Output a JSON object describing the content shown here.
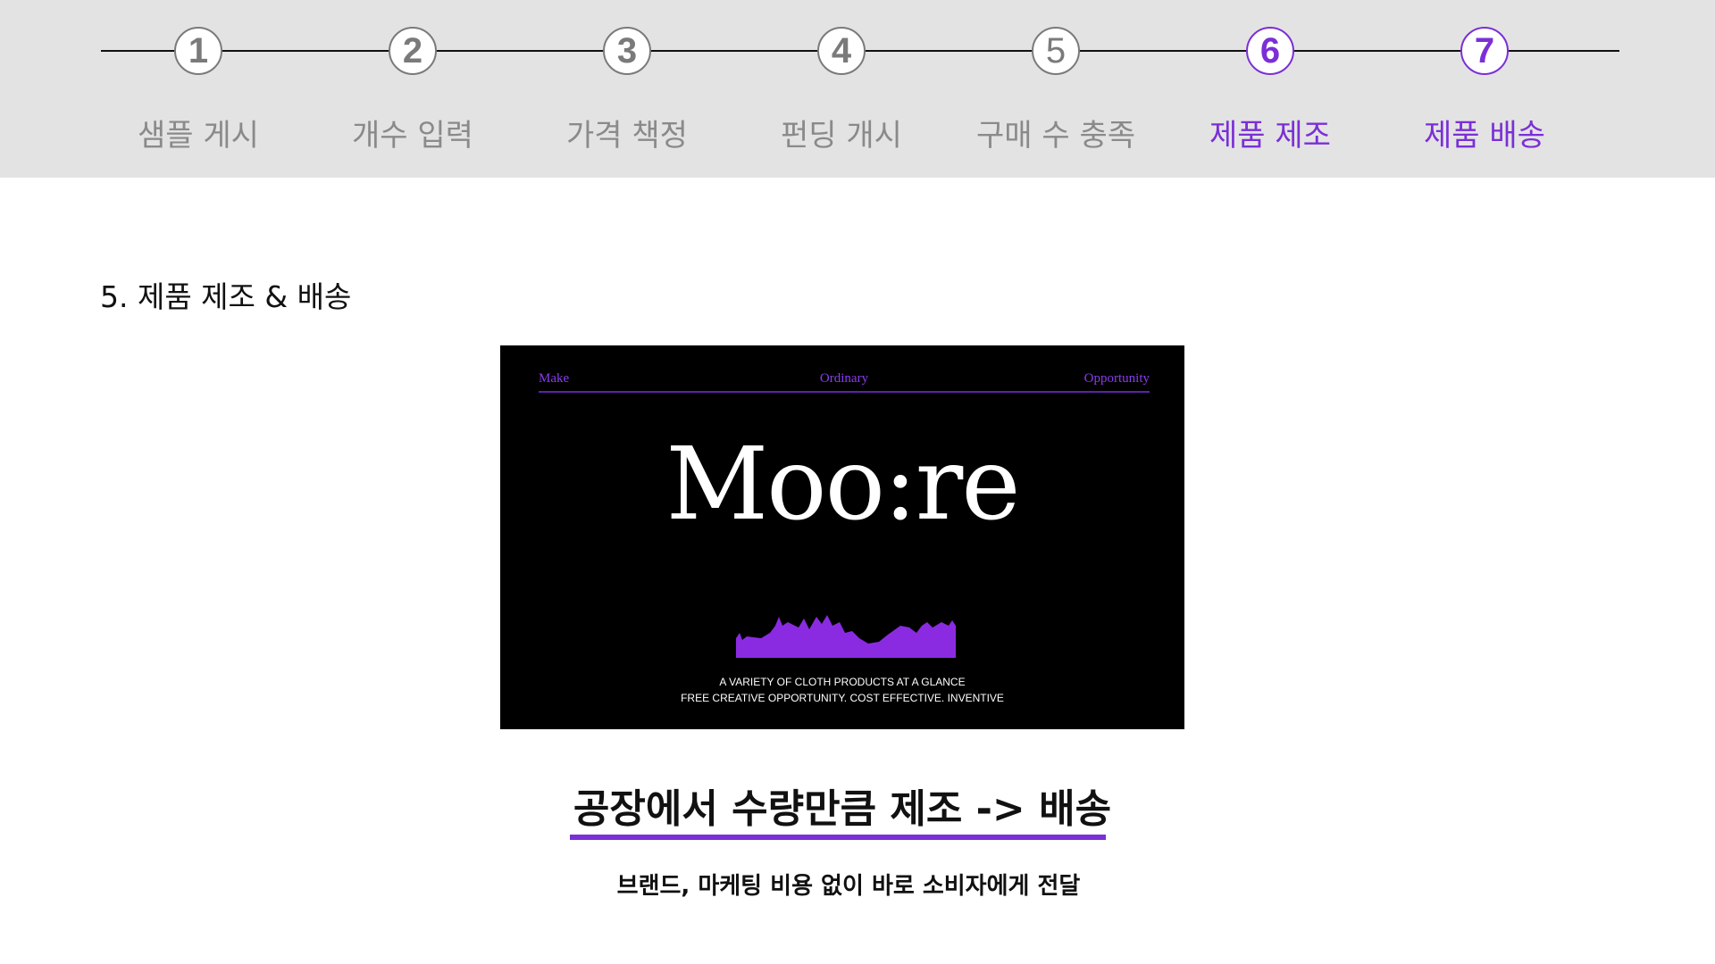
{
  "stepper": {
    "steps": [
      {
        "number": "1",
        "label": "샘플 게시"
      },
      {
        "number": "2",
        "label": "개수 입력"
      },
      {
        "number": "3",
        "label": "가격 책정"
      },
      {
        "number": "4",
        "label": "펀딩 개시"
      },
      {
        "number": "5",
        "label": "구매 수 충족"
      },
      {
        "number": "6",
        "label": "제품 제조"
      },
      {
        "number": "7",
        "label": "제품 배송"
      }
    ],
    "active_steps": [
      "6",
      "7"
    ],
    "inactive_color": "#7a7a7a",
    "active_color": "#7b2fd6"
  },
  "section": {
    "title": "5. 제품 제조 & 배송"
  },
  "banner": {
    "nav": [
      "Make",
      "Ordinary",
      "Opportunity"
    ],
    "logo": "Moo:re",
    "art_icon": "cat-silhouettes-icon",
    "tagline_1": "A VARIETY OF CLOTH PRODUCTS AT A GLANCE",
    "tagline_2": "FREE CREATIVE OPPORTUNITY. COST EFFECTIVE. INVENTIVE",
    "accent_color": "#8a3cf0"
  },
  "caption": {
    "headline": "공장에서 수량만큼 제조 -> 배송",
    "subline": "브랜드, 마케팅 비용 없이 바로 소비자에게 전달"
  }
}
